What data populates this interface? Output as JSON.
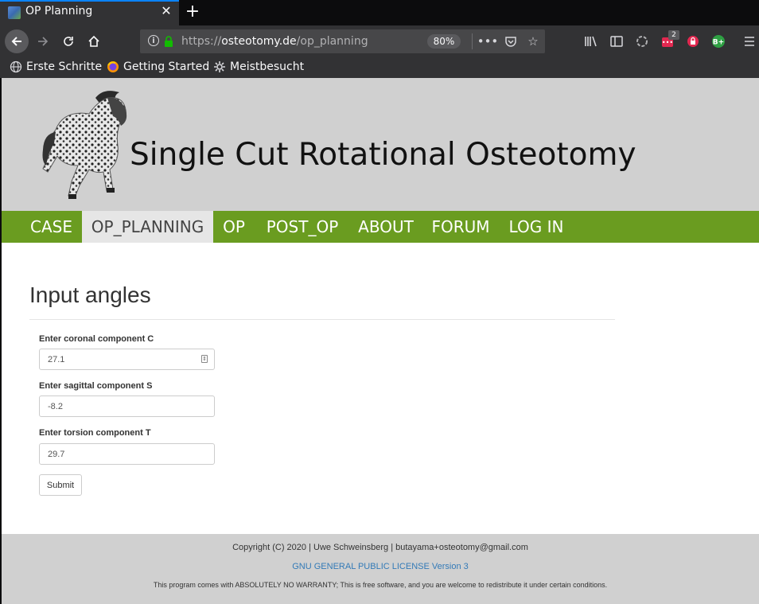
{
  "browser": {
    "tab": {
      "title": "OP Planning",
      "close": "✕"
    },
    "new_tab": "+",
    "url": {
      "scheme": "https://",
      "host": "osteotomy.de",
      "path": "/op_planning"
    },
    "zoom": "80%",
    "notification_badge": "2",
    "bookmarks": [
      {
        "label": "Erste Schritte",
        "icon": "globe-icon"
      },
      {
        "label": "Getting Started",
        "icon": "firefox-icon"
      },
      {
        "label": "Meistbesucht",
        "icon": "gear-icon"
      }
    ],
    "accent_color": "#0a84ff"
  },
  "site": {
    "title": "Single Cut Rotational Osteotomy",
    "nav": [
      "CASE",
      "OP_PLANNING",
      "OP",
      "POST_OP",
      "ABOUT",
      "FORUM",
      "LOG IN"
    ],
    "active_nav": "OP_PLANNING",
    "nav_color": "#6a9c20"
  },
  "form": {
    "heading": "Input angles",
    "fields": [
      {
        "label": "Enter coronal component C",
        "value": "27.1"
      },
      {
        "label": "Enter sagittal component S",
        "value": "-8.2"
      },
      {
        "label": "Enter torsion component T",
        "value": "29.7"
      }
    ],
    "submit": "Submit"
  },
  "footer": {
    "copyright": "Copyright (C) 2020 | Uwe Schweinsberg | butayama+osteotomy@gmail.com",
    "license": "GNU GENERAL PUBLIC LICENSE Version 3",
    "warranty": "This program comes with ABSOLUTELY NO WARRANTY; This is free software, and you are welcome to redistribute it under certain conditions."
  }
}
